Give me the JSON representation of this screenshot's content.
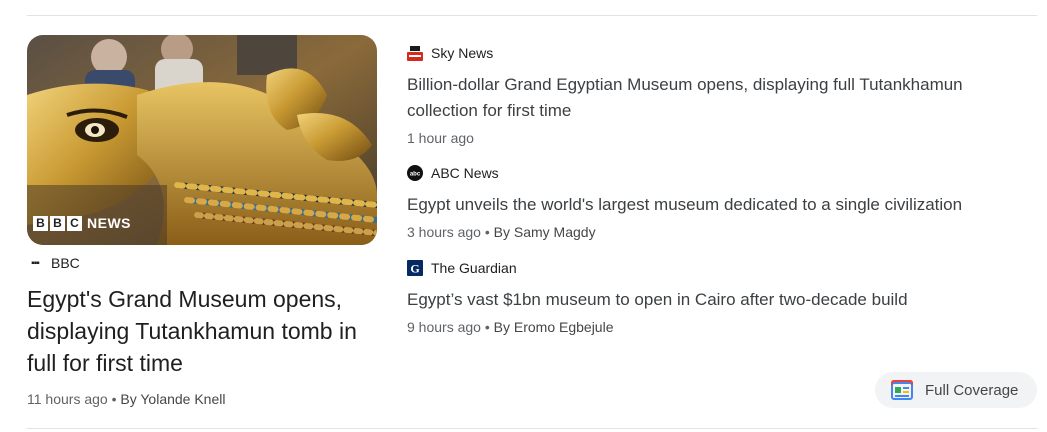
{
  "main_story": {
    "image_alt": "Golden Tutankhamun sarcophagus with BBC NEWS watermark",
    "image_watermark": {
      "blocks": [
        "B",
        "B",
        "C"
      ],
      "text": "NEWS"
    },
    "source": "BBC",
    "headline": "Egypt's Grand Museum opens, displaying Tutankhamun tomb in full for first time",
    "time": "11 hours ago",
    "separator": " • ",
    "author": "By Yolande Knell"
  },
  "side_stories": [
    {
      "source": "Sky News",
      "logo_icon": "sky-news-logo-icon",
      "headline": "Billion-dollar Grand Egyptian Museum opens, displaying full Tutankhamun collection for first time",
      "time": "1 hour ago",
      "author": ""
    },
    {
      "source": "ABC News",
      "logo_icon": "abc-news-logo-icon",
      "headline": "Egypt unveils the world's largest museum dedicated to a single civilization",
      "time": "3 hours ago",
      "separator": " • ",
      "author": "By Samy Magdy"
    },
    {
      "source": "The Guardian",
      "logo_icon": "guardian-logo-icon",
      "headline": "Egypt’s vast $1bn museum to open in Cairo after two-decade build",
      "time": "9 hours ago",
      "separator": " • ",
      "author": "By Eromo Egbejule"
    }
  ],
  "full_coverage": {
    "label": "Full Coverage",
    "icon": "full-coverage-icon"
  },
  "colors": {
    "text_primary": "#1f1f1f",
    "text_secondary": "#5f6368",
    "sky_red": "#d52b1e",
    "guardian_blue": "#052962",
    "button_bg": "#f1f3f4"
  }
}
